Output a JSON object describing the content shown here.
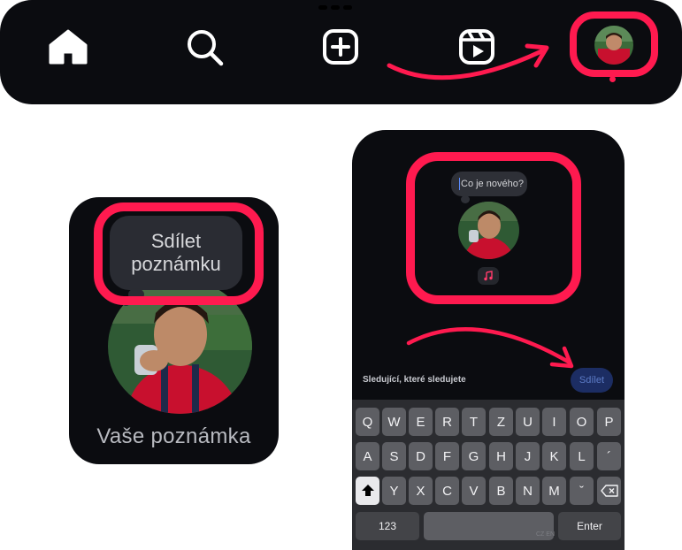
{
  "colors": {
    "highlight": "#ff1a4f",
    "panel": "#0b0c10",
    "share_button_bg": "#1c2d63",
    "share_button_text": "#5d7cc7"
  },
  "navbar": {
    "icons": [
      "home-icon",
      "search-icon",
      "create-icon",
      "reels-icon",
      "profile-avatar"
    ]
  },
  "note_card": {
    "bubble_line1": "Sdílet",
    "bubble_line2": "poznámku",
    "label": "Vaše poznámka"
  },
  "compose": {
    "placeholder": "Co je nového?",
    "audience_label": "Sledující, které sledujete",
    "share_label": "Sdílet",
    "music_icon": "music-note-icon"
  },
  "keyboard": {
    "row1": [
      "Q",
      "W",
      "E",
      "R",
      "T",
      "Z",
      "U",
      "I",
      "O",
      "P"
    ],
    "row2": [
      "A",
      "S",
      "D",
      "F",
      "G",
      "H",
      "J",
      "K",
      "L",
      "´"
    ],
    "row3": [
      "Y",
      "X",
      "C",
      "V",
      "B",
      "N",
      "M",
      "ˇ"
    ],
    "numbers_label": "123",
    "enter_label": "Enter",
    "language_label": "CZ EN",
    "shift_icon": "shift-icon",
    "backspace_icon": "backspace-icon"
  }
}
